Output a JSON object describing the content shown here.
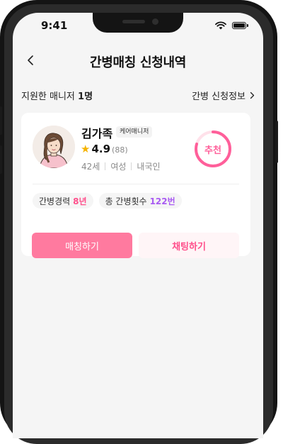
{
  "status_bar": {
    "time": "9:41"
  },
  "header": {
    "title": "간병매칭 신청내역"
  },
  "summary": {
    "applied_prefix": "지원한 매니저",
    "applied_count": "1명",
    "app_info_label": "간병 신청정보"
  },
  "manager": {
    "name": "김가족",
    "role_badge": "케어매니저",
    "rating": "4.9",
    "reviews": "(88)",
    "age": "42세",
    "gender": "여성",
    "nationality": "내국인",
    "recommend_label": "추천",
    "experience_label": "간병경력",
    "experience_value": "8년",
    "total_label": "총 간병횟수",
    "total_value": "122번"
  },
  "actions": {
    "match_label": "매칭하기",
    "chat_label": "채팅하기"
  },
  "colors": {
    "accent_pink": "#ff4f8b",
    "button_pink": "#ff7a9f",
    "purple": "#a95bf2",
    "star": "#f5b301"
  }
}
